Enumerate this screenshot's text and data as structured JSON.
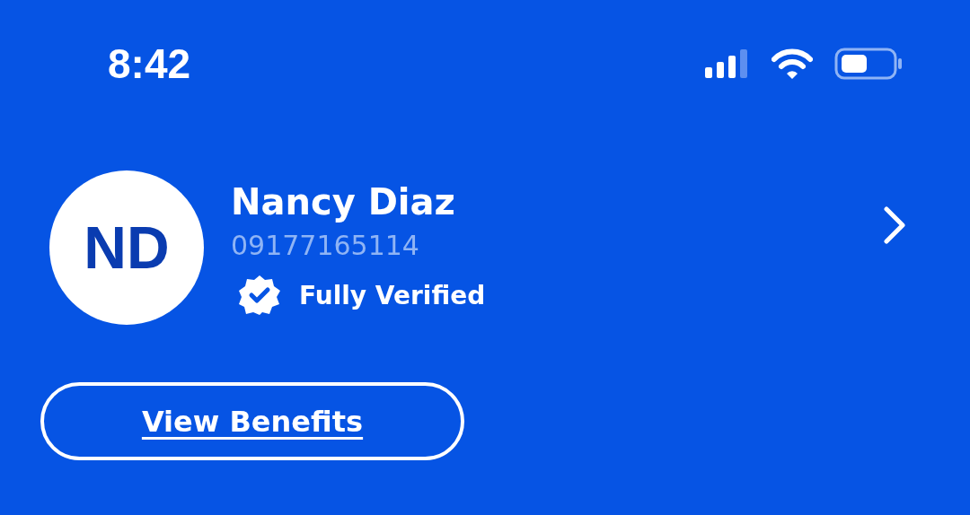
{
  "status_bar": {
    "time": "8:42"
  },
  "profile": {
    "initials": "ND",
    "name": "Nancy Diaz",
    "phone": "09177165114",
    "verification": "Fully Verified"
  },
  "button": {
    "label": "View Benefits"
  }
}
